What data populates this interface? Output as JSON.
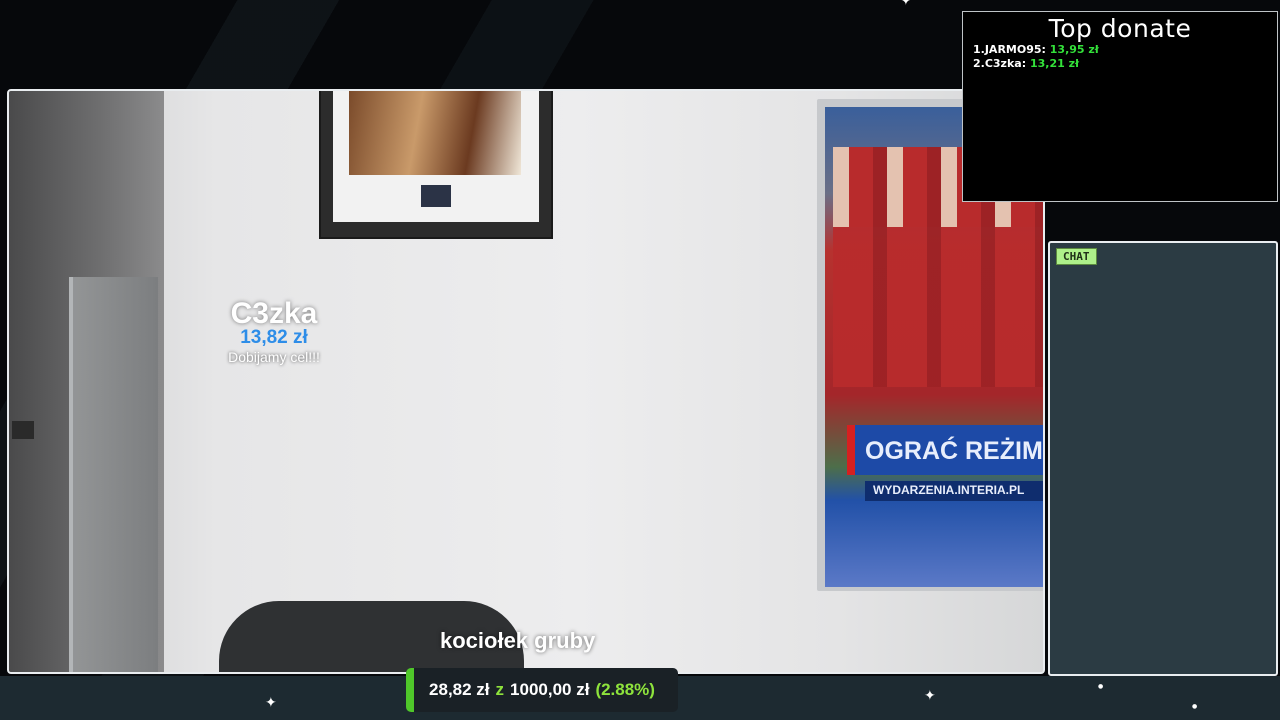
{
  "camera_overlay": {
    "donor_name": "C3zka",
    "donor_amount": "13,82 zł",
    "donor_message": "Dobijamy cel!!!",
    "caption": "kociołek gruby"
  },
  "tv_screen": {
    "banner": "OGRAĆ REŻIM",
    "subbanner": "WYDARZENIA.INTERIA.PL"
  },
  "top_donate": {
    "title": "Top donate",
    "entries": [
      {
        "label": "1.JARMO95:",
        "amount": "13,95 zł"
      },
      {
        "label": "2.C3zka:",
        "amount": "13,21 zł"
      }
    ]
  },
  "chat": {
    "tag": "CHAT"
  },
  "goal": {
    "current": "28,82 zł",
    "separator": "z",
    "target": "1000,00 zł",
    "percent_text": "(2.88%)",
    "progress_fraction": 0.0288,
    "colors": {
      "fill": "#4fc72a",
      "accent": "#8ee33c"
    }
  },
  "colors": {
    "donor_amount": "#2d8de8",
    "top_donate_amount": "#33e13a",
    "chat_bg": "#2b3b43",
    "chat_tag": "#aef08a"
  }
}
